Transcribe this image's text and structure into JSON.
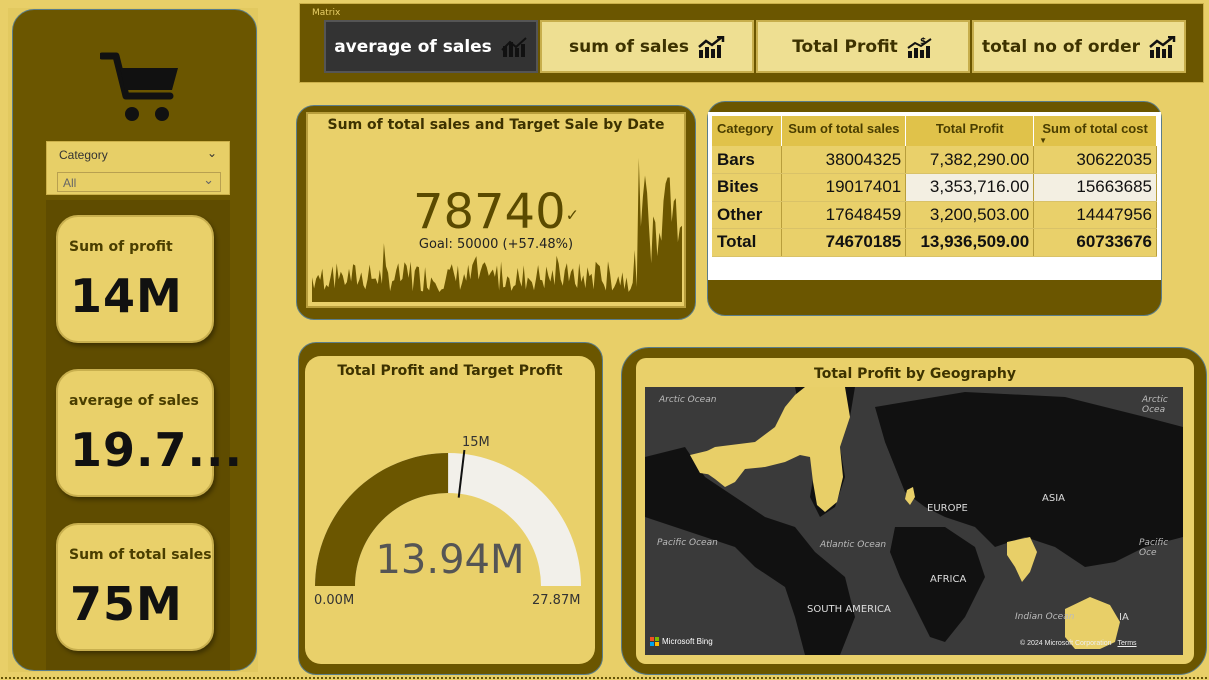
{
  "left": {
    "slicer": {
      "title": "Category",
      "value": "All"
    },
    "kpis": [
      {
        "label": "Sum of profit",
        "value": "14M"
      },
      {
        "label": "average of sales",
        "value": "19.7..."
      },
      {
        "label": "Sum of total sales",
        "value": "75M"
      }
    ]
  },
  "topbar": {
    "label": "Matrix",
    "tabs": [
      {
        "label": "average of sales",
        "icon": "bar-chart-icon"
      },
      {
        "label": "sum of sales",
        "icon": "trend-up-icon"
      },
      {
        "label": "Total Profit",
        "icon": "profit-chart-icon"
      },
      {
        "label": "total no of order",
        "icon": "trend-up-icon"
      }
    ]
  },
  "kpi_card": {
    "title": "Sum of total sales and Target Sale by Date",
    "value": "78740",
    "goal": "Goal: 50000 (+57.48%)"
  },
  "matrix": {
    "headers": [
      "Category",
      "Sum of total sales",
      "Total Profit",
      "Sum of total cost"
    ],
    "rows": [
      [
        "Bars",
        "38004325",
        "7,382,290.00",
        "30622035"
      ],
      [
        "Bites",
        "19017401",
        "3,353,716.00",
        "15663685"
      ],
      [
        "Other",
        "17648459",
        "3,200,503.00",
        "14447956"
      ],
      [
        "Total",
        "74670185",
        "13,936,509.00",
        "60733676"
      ]
    ]
  },
  "gauge": {
    "title": "Total Profit and Target Profit",
    "value_label": "13.94M",
    "min_label": "0.00M",
    "max_label": "27.87M",
    "target_label": "15M",
    "value": 13.94,
    "min": 0,
    "max": 27.87,
    "target": 15
  },
  "geo": {
    "title": "Total Profit by Geography",
    "labels": {
      "arctic_left": "Arctic Ocean",
      "arctic_right": "Arctic Ocea",
      "pacific_left": "Pacific Ocean",
      "pacific_right": "Pacific Oce",
      "atlantic": "Atlantic Ocean",
      "indian": "Indian Ocean",
      "europe": "EUROPE",
      "asia": "ASIA",
      "africa": "AFRICA",
      "south_america": "SOUTH AMERICA",
      "australia_partial": "IA"
    },
    "bing": "Microsoft Bing",
    "copyright": "© 2024 Microsoft Corporation",
    "terms": "Terms"
  },
  "colors": {
    "background": "#e8cf68",
    "panel": "#6b5600",
    "card": "#e9d06a",
    "accent": "#e0c24a",
    "active_tab": "#333333"
  }
}
